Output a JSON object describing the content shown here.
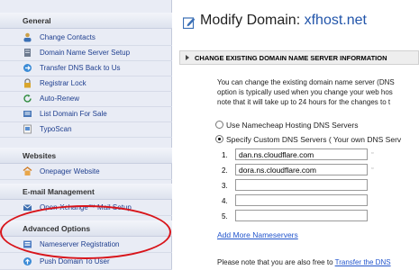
{
  "sidebar": {
    "general_heading": "General",
    "general_items": [
      {
        "label": "Change Contacts",
        "icon": "contacts-icon"
      },
      {
        "label": "Domain Name Server Setup",
        "icon": "server-icon"
      },
      {
        "label": "Transfer DNS Back to Us",
        "icon": "transfer-icon"
      },
      {
        "label": "Registrar Lock",
        "icon": "lock-icon"
      },
      {
        "label": "Auto-Renew",
        "icon": "renew-icon"
      },
      {
        "label": "List Domain For Sale",
        "icon": "sale-icon"
      },
      {
        "label": "TypoScan",
        "icon": "typoscan-icon"
      }
    ],
    "websites_heading": "Websites",
    "websites_items": [
      {
        "label": "Onepager Website",
        "icon": "website-icon"
      }
    ],
    "email_heading": "E-mail Management",
    "email_items": [
      {
        "label": "Open-Xchange™ Mail Setup",
        "icon": "mail-icon"
      }
    ],
    "advanced_heading": "Advanced Options",
    "advanced_items": [
      {
        "label": "Nameserver Registration",
        "icon": "nameserver-icon"
      },
      {
        "label": "Push Domain To User",
        "icon": "push-icon"
      }
    ]
  },
  "main": {
    "title_prefix": "Modify Domain:",
    "domain": "xfhost.net",
    "section_bar": "CHANGE EXISTING DOMAIN NAME SERVER INFORMATION",
    "para_lines": [
      "You can change the existing domain name server (DNS",
      "option is typically used when you change your web hos",
      "note that it will take up to 24 hours for the changes to t"
    ],
    "radio_hosting": "Use Namecheap Hosting DNS Servers",
    "radio_custom": "Specify Custom DNS Servers ( Your own DNS Serv",
    "nameservers": [
      {
        "num": "1.",
        "value": "dan.ns.cloudflare.com"
      },
      {
        "num": "2.",
        "value": "dora.ns.cloudflare.com"
      },
      {
        "num": "3.",
        "value": ""
      },
      {
        "num": "4.",
        "value": ""
      },
      {
        "num": "5.",
        "value": ""
      }
    ],
    "add_more": "Add More Nameservers",
    "bottom_text": "Please note that you are also free to",
    "bottom_link": "Transfer the DNS"
  },
  "colors": {
    "highlight": "#d8141a",
    "link": "#2255cc"
  }
}
